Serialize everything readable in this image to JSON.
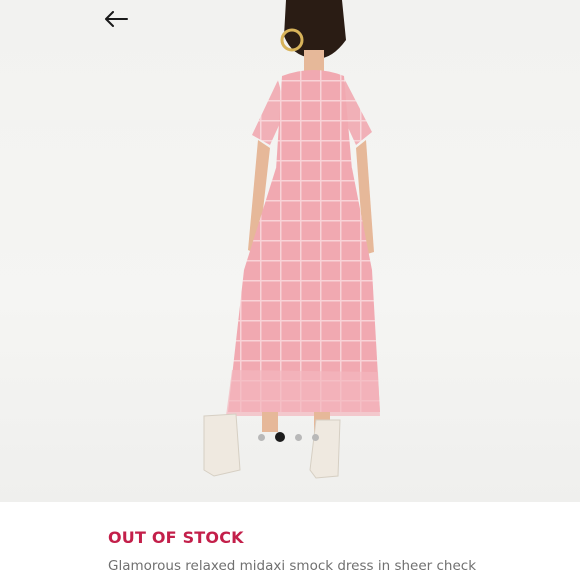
{
  "product": {
    "status": "OUT OF STOCK",
    "title": "Glamorous relaxed midaxi smock dress in sheer check"
  },
  "carousel": {
    "dot_count": 4,
    "active_index": 1
  },
  "icons": {
    "back": "back-arrow-icon"
  },
  "colors": {
    "status": "#c31f4a",
    "dress": "#f0aab2",
    "active_dot": "#1c1c1c"
  }
}
